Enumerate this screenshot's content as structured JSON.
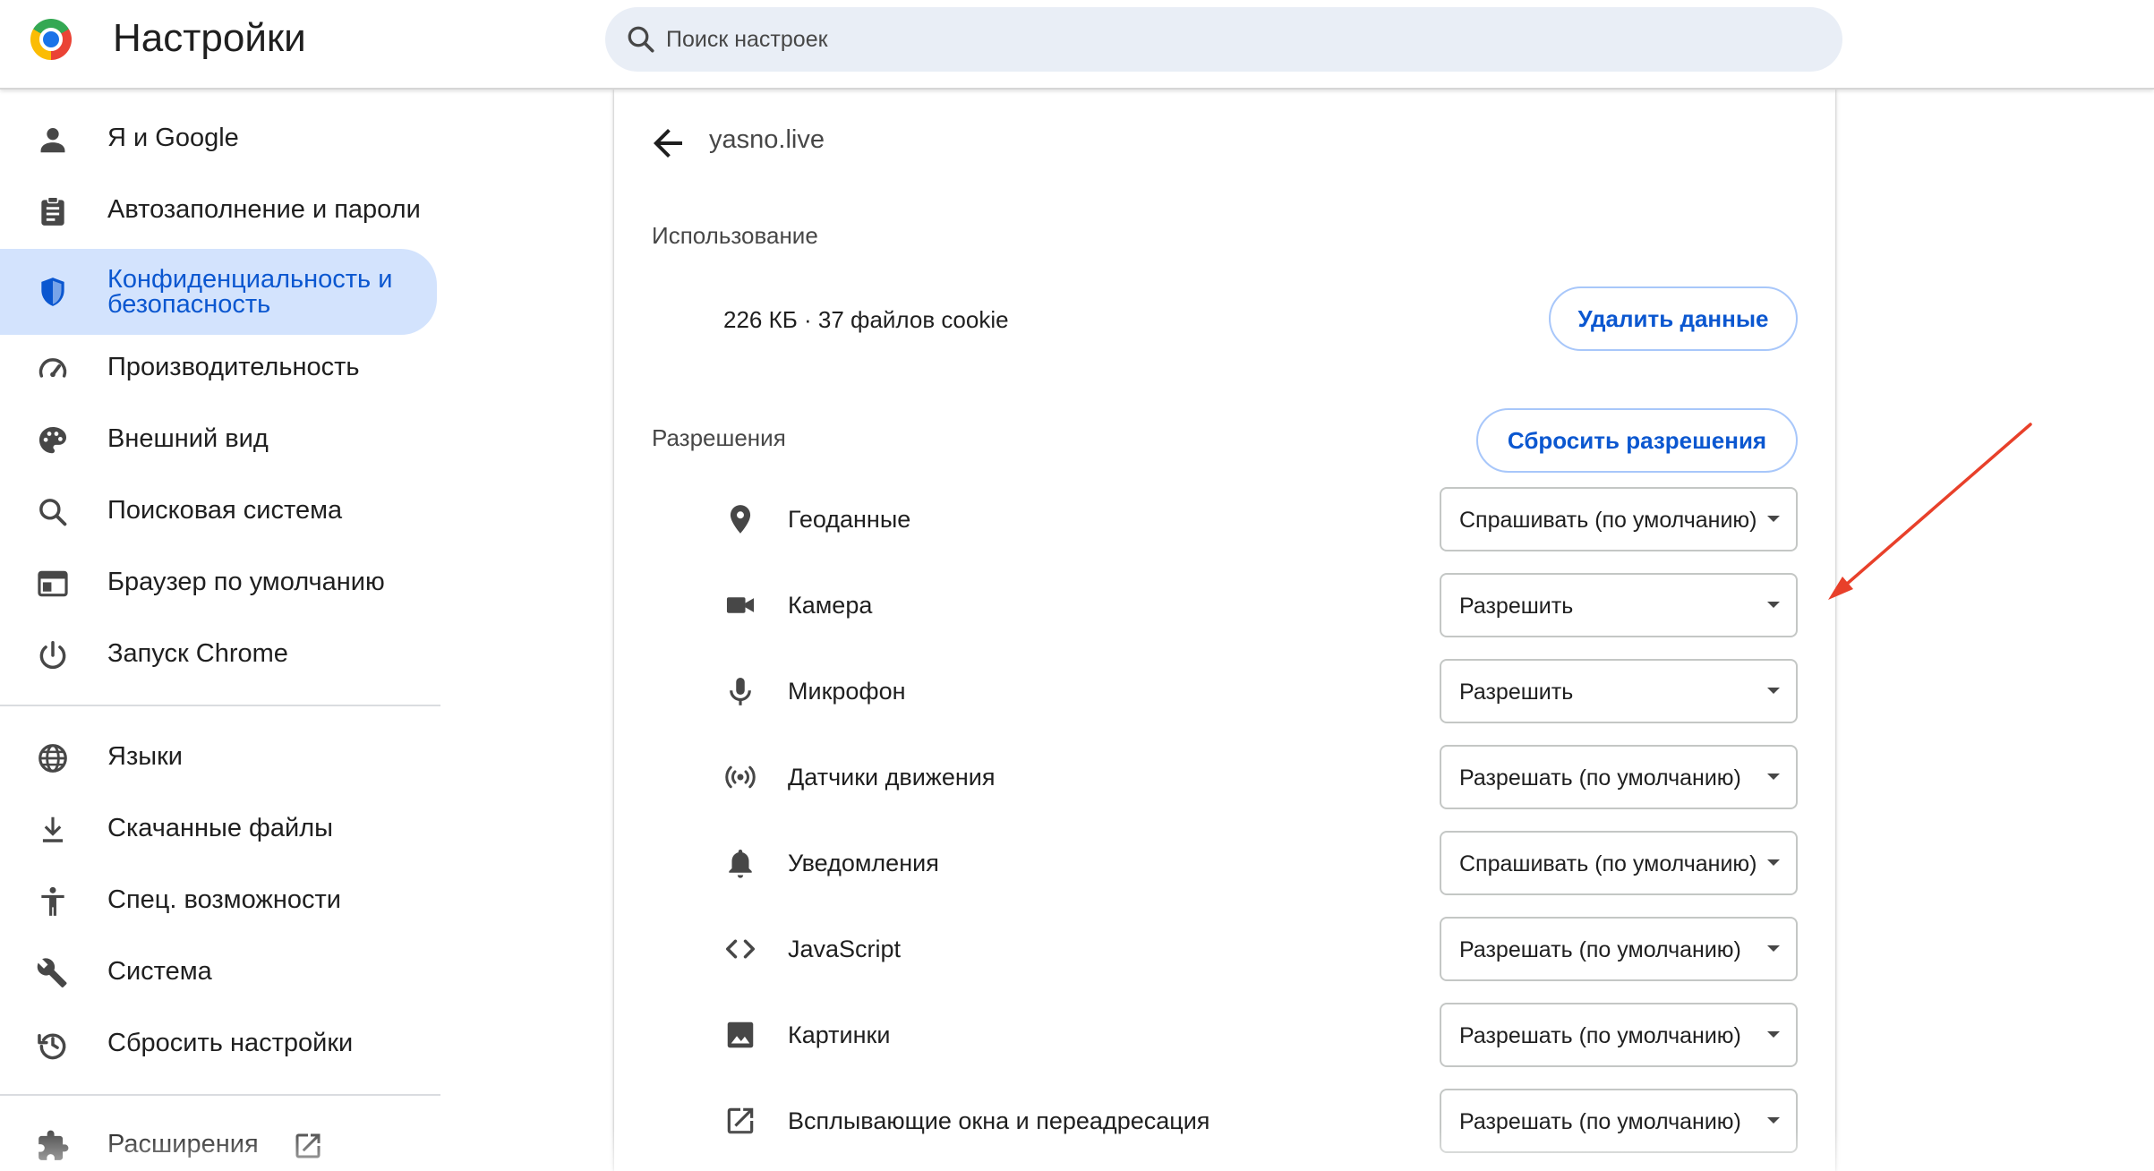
{
  "header": {
    "title": "Настройки",
    "search_placeholder": "Поиск настроек"
  },
  "sidebar": {
    "items": [
      {
        "label": "Я и Google",
        "icon": "person-icon"
      },
      {
        "label": "Автозаполнение и пароли",
        "icon": "clipboard-icon"
      },
      {
        "label": "Конфиденциальность и безопасность",
        "icon": "shield-icon",
        "active": true
      },
      {
        "label": "Производительность",
        "icon": "speedometer-icon"
      },
      {
        "label": "Внешний вид",
        "icon": "palette-icon"
      },
      {
        "label": "Поисковая система",
        "icon": "search-icon"
      },
      {
        "label": "Браузер по умолчанию",
        "icon": "browser-window-icon"
      },
      {
        "label": "Запуск Chrome",
        "icon": "power-icon"
      },
      {
        "label": "Языки",
        "icon": "globe-icon"
      },
      {
        "label": "Скачанные файлы",
        "icon": "download-icon"
      },
      {
        "label": "Спец. возможности",
        "icon": "accessibility-icon"
      },
      {
        "label": "Система",
        "icon": "wrench-icon"
      },
      {
        "label": "Сбросить настройки",
        "icon": "history-icon"
      },
      {
        "label": "Расширения",
        "icon": "puzzle-icon"
      }
    ]
  },
  "site": {
    "name": "yasno.live",
    "usage_title": "Использование",
    "usage_text": "226 КБ · 37 файлов cookie",
    "delete_button": "Удалить данные",
    "permissions_title": "Разрешения",
    "reset_button": "Сбросить разрешения"
  },
  "permissions": [
    {
      "label": "Геоданные",
      "value": "Спрашивать (по умолчанию)",
      "icon": "location-pin-icon"
    },
    {
      "label": "Камера",
      "value": "Разрешить",
      "icon": "video-camera-icon"
    },
    {
      "label": "Микрофон",
      "value": "Разрешить",
      "icon": "microphone-icon"
    },
    {
      "label": "Датчики движения",
      "value": "Разрешать (по умолчанию)",
      "icon": "sensors-icon"
    },
    {
      "label": "Уведомления",
      "value": "Спрашивать (по умолчанию)",
      "icon": "bell-icon"
    },
    {
      "label": "JavaScript",
      "value": "Разрешать (по умолчанию)",
      "icon": "code-icon"
    },
    {
      "label": "Картинки",
      "value": "Разрешать (по умолчанию)",
      "icon": "image-icon"
    },
    {
      "label": "Всплывающие окна и переадресация",
      "value": "Разрешать (по умолчанию)",
      "icon": "open-in-new-icon"
    }
  ],
  "colors": {
    "accent": "#0b57d0",
    "active_nav_bg": "#d3e3fd",
    "annotation_arrow": "#e8402a"
  }
}
